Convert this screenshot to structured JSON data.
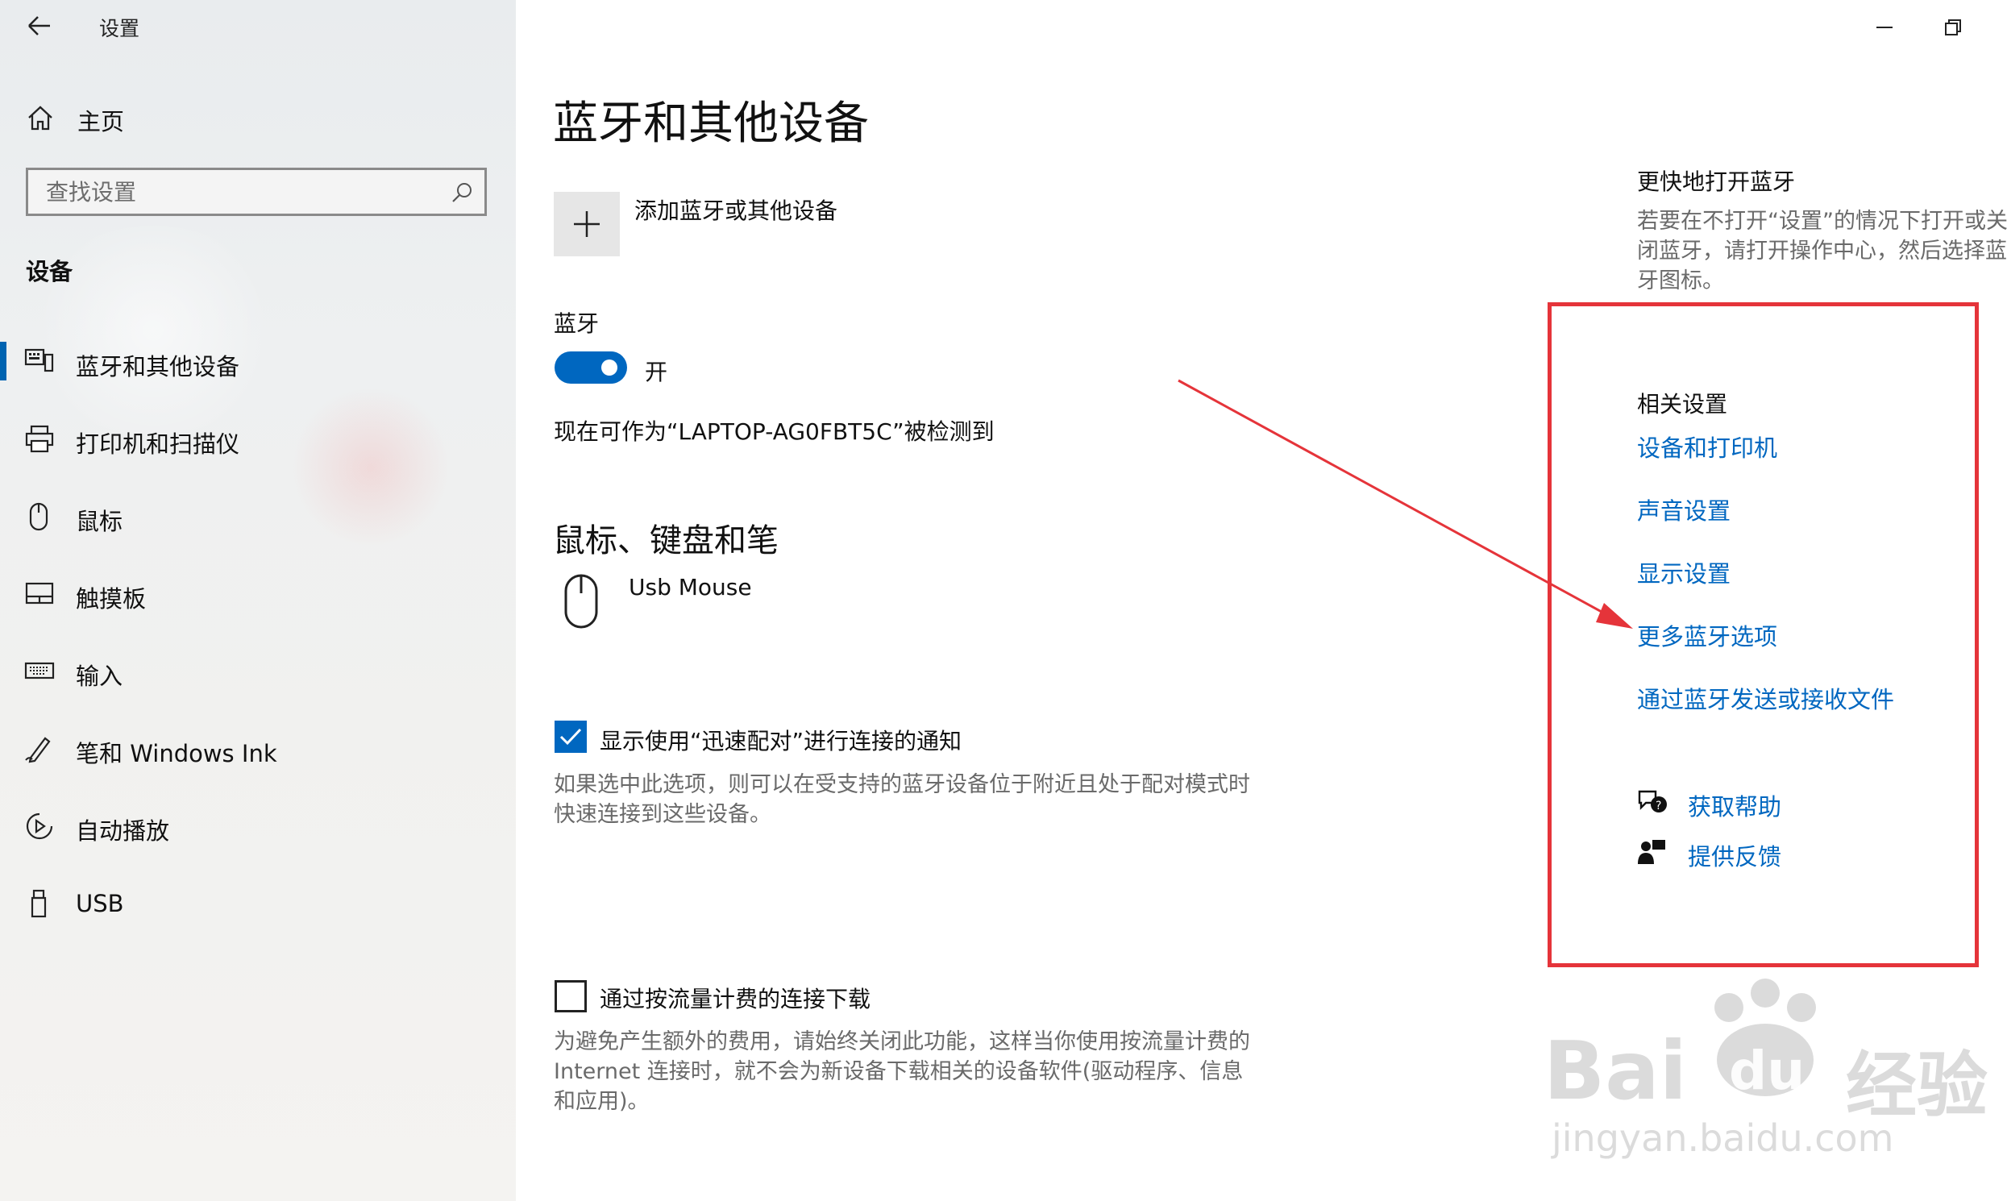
{
  "window": {
    "title": "设置",
    "back_icon": "back-arrow-icon",
    "minimize_icon": "minimize-icon",
    "restore_icon": "restore-icon"
  },
  "sidebar": {
    "home_label": "主页",
    "search_placeholder": "查找设置",
    "section_title": "设备",
    "items": [
      {
        "label": "蓝牙和其他设备",
        "icon": "bluetooth-devices-icon",
        "selected": true
      },
      {
        "label": "打印机和扫描仪",
        "icon": "printer-icon"
      },
      {
        "label": "鼠标",
        "icon": "mouse-icon"
      },
      {
        "label": "触摸板",
        "icon": "touchpad-icon"
      },
      {
        "label": "输入",
        "icon": "keyboard-icon"
      },
      {
        "label": "笔和 Windows Ink",
        "icon": "pen-icon"
      },
      {
        "label": "自动播放",
        "icon": "autoplay-icon"
      },
      {
        "label": "USB",
        "icon": "usb-icon"
      }
    ]
  },
  "main": {
    "page_title": "蓝牙和其他设备",
    "add_device_label": "添加蓝牙或其他设备",
    "bluetooth_label": "蓝牙",
    "bluetooth_toggle_state": "开",
    "discoverable_text": "现在可作为“LAPTOP-AG0FBT5C”被检测到",
    "section_mouse_keyboard": "鼠标、键盘和笔",
    "device_name": "Usb Mouse",
    "swift_pair_label": "显示使用“迅速配对”进行连接的通知",
    "swift_pair_checked": true,
    "swift_pair_desc_1": "如果选中此选项，则可以在受支持的蓝牙设备位于附近且处于配对模式时",
    "swift_pair_desc_2": "快速连接到这些设备。",
    "metered_label": "通过按流量计费的连接下载",
    "metered_checked": false,
    "metered_desc_1": "为避免产生额外的费用，请始终关闭此功能，这样当你使用按流量计费的",
    "metered_desc_2": "Internet 连接时，就不会为新设备下载相关的设备软件(驱动程序、信息",
    "metered_desc_3": "和应用)。"
  },
  "right_panel": {
    "quick_title": "更快地打开蓝牙",
    "quick_desc_1": "若要在不打开“设置”的情况下打开或关",
    "quick_desc_2": "闭蓝牙，请打开操作中心，然后选择蓝",
    "quick_desc_3": "牙图标。",
    "related_title": "相关设置",
    "links": [
      "设备和打印机",
      "声音设置",
      "显示设置",
      "更多蓝牙选项",
      "通过蓝牙发送或接收文件"
    ],
    "help_label": "获取帮助",
    "feedback_label": "提供反馈"
  },
  "annotation": {
    "color": "#e5343a"
  },
  "watermark": {
    "brand": "Bai",
    "du": "du",
    "jingyan": "经验",
    "url": "jingyan.baidu.com"
  }
}
